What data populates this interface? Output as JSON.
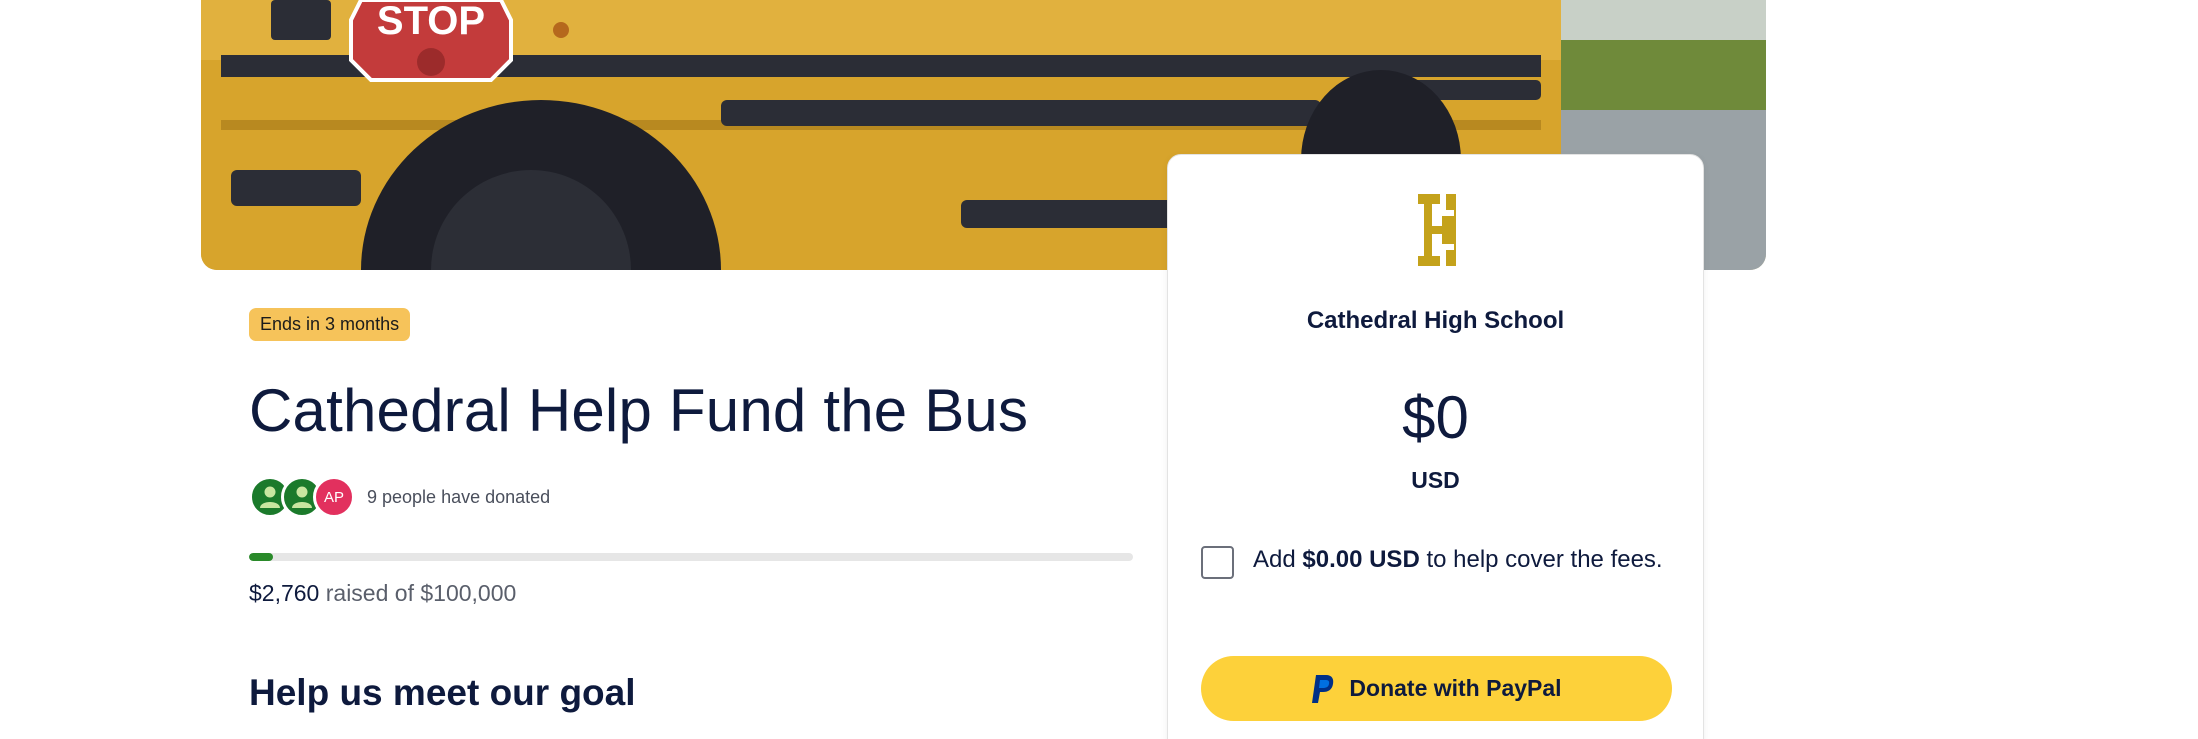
{
  "campaign": {
    "badge": "Ends in 3 months",
    "title": "Cathedral Help Fund the Bus",
    "donors": {
      "avatars": [
        {
          "type": "icon",
          "icon": "person-icon",
          "color": "#1b7a2b"
        },
        {
          "type": "icon",
          "icon": "person-icon",
          "color": "#1b7a2b"
        },
        {
          "type": "initials",
          "initials": "AP",
          "color": "#e2305e"
        }
      ],
      "text": "9 people have donated"
    },
    "progress_fraction": 0.0276,
    "raised_amount": "$2,760",
    "raised_suffix": " raised of $100,000",
    "subheading": "Help us meet our goal"
  },
  "card": {
    "org_name": "Cathedral High School",
    "amount": "$0",
    "currency": "USD",
    "fee_prefix": "Add ",
    "fee_amount": "$0.00 USD",
    "fee_suffix": " to help cover the fees.",
    "donate_label": "Donate with PayPal",
    "donate_icon": "paypal-icon",
    "logo_icon": "cathedral-logo-icon",
    "accent_color": "#fdd13a",
    "logo_color": "#c4a21b"
  },
  "hero": {
    "sign_text": "STOP"
  }
}
